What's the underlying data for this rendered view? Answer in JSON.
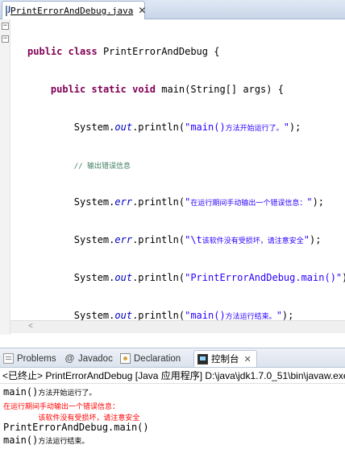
{
  "editor_tab": {
    "label": "PrintErrorAndDebug.java",
    "close": "✕"
  },
  "code": {
    "l1": {
      "kw1": "public",
      "kw2": "class",
      "rest": " PrintErrorAndDebug {"
    },
    "l2": {
      "kw1": "public",
      "kw2": "static",
      "kw3": "void",
      "rest": " main(String[] args) {"
    },
    "l3": {
      "pre": "System.",
      "field": "out",
      "mid": ".println(",
      "str_ascii": "\"main()",
      "str_cn": "方法开始运行了。",
      "str_end": "\"",
      "end": ");"
    },
    "l4": {
      "comment": "// 输出错误信息"
    },
    "l5": {
      "pre": "System.",
      "field": "err",
      "mid": ".println(",
      "str_ascii": "\"",
      "str_cn": "在运行期间手动输出一个错误信息：",
      "str_end": "\"",
      "end": ");"
    },
    "l6": {
      "pre": "System.",
      "field": "err",
      "mid": ".println(",
      "str_ascii": "\"\\t",
      "str_cn": "该软件没有受损坏，请注意安全",
      "str_end": "\"",
      "end": ");"
    },
    "l7": {
      "pre": "System.",
      "field": "out",
      "mid": ".println(",
      "str_ascii": "\"PrintErrorAndDebug.main()\"",
      "end": ");"
    },
    "l8": {
      "pre": "System.",
      "field": "out",
      "mid": ".println(",
      "str_ascii": "\"main()",
      "str_cn": "方法运行结束。",
      "str_end": "\"",
      "end": ");"
    },
    "l9": "}",
    "l10": "}"
  },
  "views": {
    "problems": "Problems",
    "javadoc": "Javadoc",
    "declaration": "Declaration",
    "console": "控制台",
    "console_close": "✕"
  },
  "console": {
    "header": "<已终止> PrintErrorAndDebug [Java 应用程序] D:\\java\\jdk1.7.0_51\\bin\\javaw.exe",
    "line1_ascii": "main()",
    "line1_cn": "方法开始运行了。",
    "line2": "在运行期间手动输出一个错误信息：",
    "line3": "        该软件没有受损坏，请注意安全",
    "line4": "PrintErrorAndDebug.main()",
    "line5_ascii": "main()",
    "line5_cn": "方法运行结束。"
  },
  "colors": {
    "keyword": "#7f0055",
    "string": "#2a00ff",
    "field": "#0000c0",
    "comment": "#3f7f5f",
    "stderr": "#ff0000"
  }
}
